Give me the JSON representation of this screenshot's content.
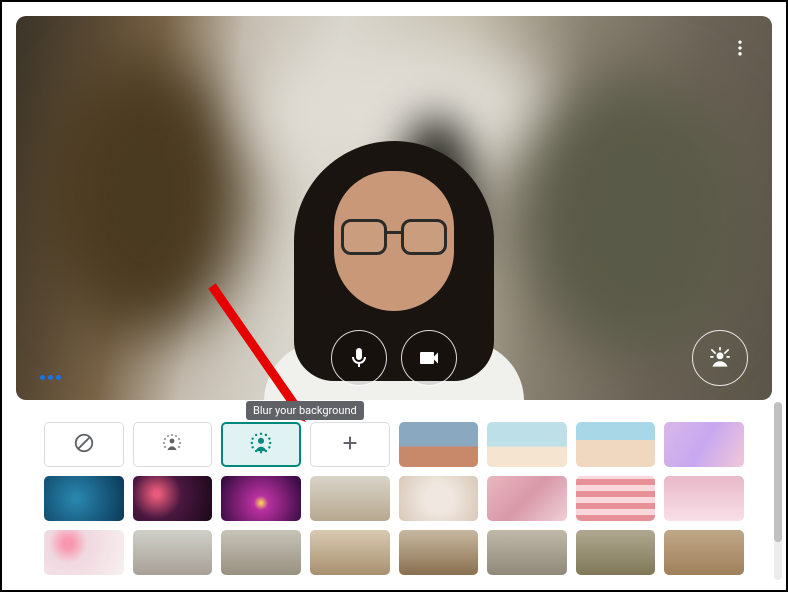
{
  "tooltip": {
    "blur": "Blur your background"
  },
  "colors": {
    "accent": "#00897b",
    "arrow": "#e60000"
  },
  "controls": {
    "mic": "mic-icon",
    "camera": "camera-icon",
    "effects": "effects-icon",
    "more": "more-icon",
    "menu": "menu-dots"
  },
  "background_options": [
    {
      "id": "none",
      "type": "action",
      "icon": "no-effect",
      "label": "Turn off background effects"
    },
    {
      "id": "blur-light",
      "type": "action",
      "icon": "blur-light",
      "label": "Slightly blur your background"
    },
    {
      "id": "blur",
      "type": "action",
      "icon": "blur",
      "label": "Blur your background",
      "selected": true
    },
    {
      "id": "upload",
      "type": "action",
      "icon": "plus",
      "label": "Upload a background image"
    },
    {
      "id": "bg1",
      "type": "image",
      "style": "linear-gradient(180deg,#8aa8c0 55%,#c8886a 55%)"
    },
    {
      "id": "bg2",
      "type": "image",
      "style": "linear-gradient(180deg,#bde0e8 55%,#f4e4d0 55%)"
    },
    {
      "id": "bg3",
      "type": "image",
      "style": "linear-gradient(180deg,#a8d8e8 40%,#f0d8c0 40%)"
    },
    {
      "id": "bg4",
      "type": "image",
      "style": "linear-gradient(120deg,#d8b8e8,#c8a8f0,#f0c8d8)"
    },
    {
      "id": "bg5",
      "type": "image",
      "style": "radial-gradient(circle at 40% 50%,#2a88b0,#0a3858)"
    },
    {
      "id": "bg6",
      "type": "image",
      "style": "radial-gradient(circle at 30% 40%,#e85a7a 5%,#4a1840 40%,#1a0818)"
    },
    {
      "id": "bg7",
      "type": "image",
      "style": "radial-gradient(circle at 50% 60%,#f8c860 2%,#b830a0 15%,#2a0838)"
    },
    {
      "id": "bg8",
      "type": "image",
      "style": "linear-gradient(180deg,#d8d4c8,#b8a890)"
    },
    {
      "id": "bg9",
      "type": "image",
      "style": "radial-gradient(circle,#f0e8e0 30%,#d8c8b8)"
    },
    {
      "id": "bg10",
      "type": "image",
      "style": "linear-gradient(135deg,#e8b8c0,#d898a8,#f0d0d8)"
    },
    {
      "id": "bg11",
      "type": "image",
      "style": "repeating-linear-gradient(0deg,#e89098 0 6px,#f8d8dc 6px 12px)"
    },
    {
      "id": "bg12",
      "type": "image",
      "style": "linear-gradient(180deg,#e8b8c8,#f8e0e8)"
    },
    {
      "id": "bg13",
      "type": "image",
      "style": "radial-gradient(circle at 30% 30%,#f898b0 8%,#f0d8e0 30%,#f8f0f0)"
    },
    {
      "id": "bg14",
      "type": "image",
      "style": "linear-gradient(180deg,#d0d0c8,#a8a098)"
    },
    {
      "id": "bg15",
      "type": "image",
      "style": "linear-gradient(180deg,#c8c4b8,#989080)"
    },
    {
      "id": "bg16",
      "type": "image",
      "style": "linear-gradient(180deg,#d8cab0,#a89070)"
    },
    {
      "id": "bg17",
      "type": "image",
      "style": "linear-gradient(180deg,#c8b8a0,#887050)"
    },
    {
      "id": "bg18",
      "type": "image",
      "style": "linear-gradient(180deg,#c0b8a8,#908878)"
    },
    {
      "id": "bg19",
      "type": "image",
      "style": "linear-gradient(180deg,#b0a890,#807858)"
    },
    {
      "id": "bg20",
      "type": "image",
      "style": "linear-gradient(180deg,#c0a888,#a0805a)"
    }
  ]
}
